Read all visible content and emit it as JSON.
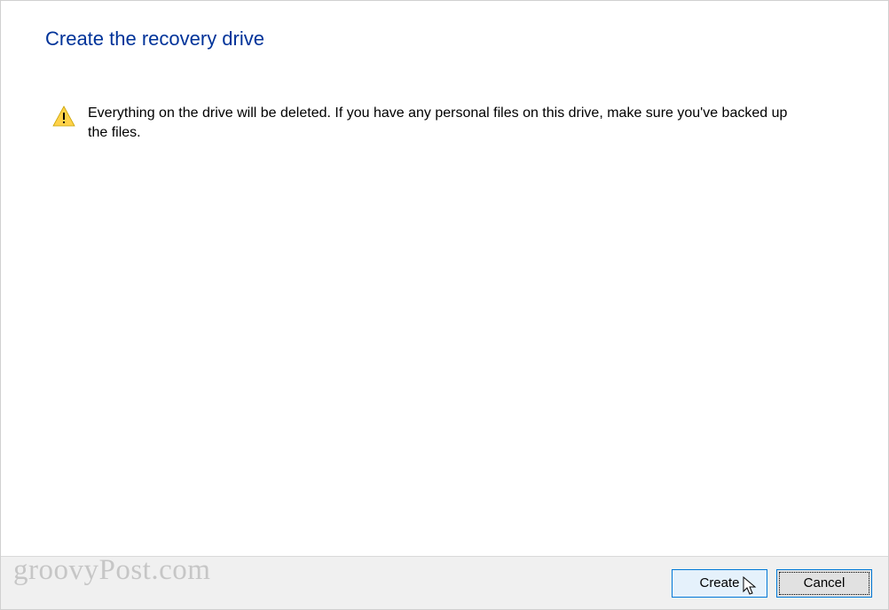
{
  "dialog": {
    "title": "Create the recovery drive",
    "warning_text": "Everything on the drive will be deleted. If you have any personal files on this drive, make sure you've backed up the files."
  },
  "footer": {
    "create_label": "Create",
    "cancel_label": "Cancel"
  },
  "watermark": "groovyPost.com"
}
